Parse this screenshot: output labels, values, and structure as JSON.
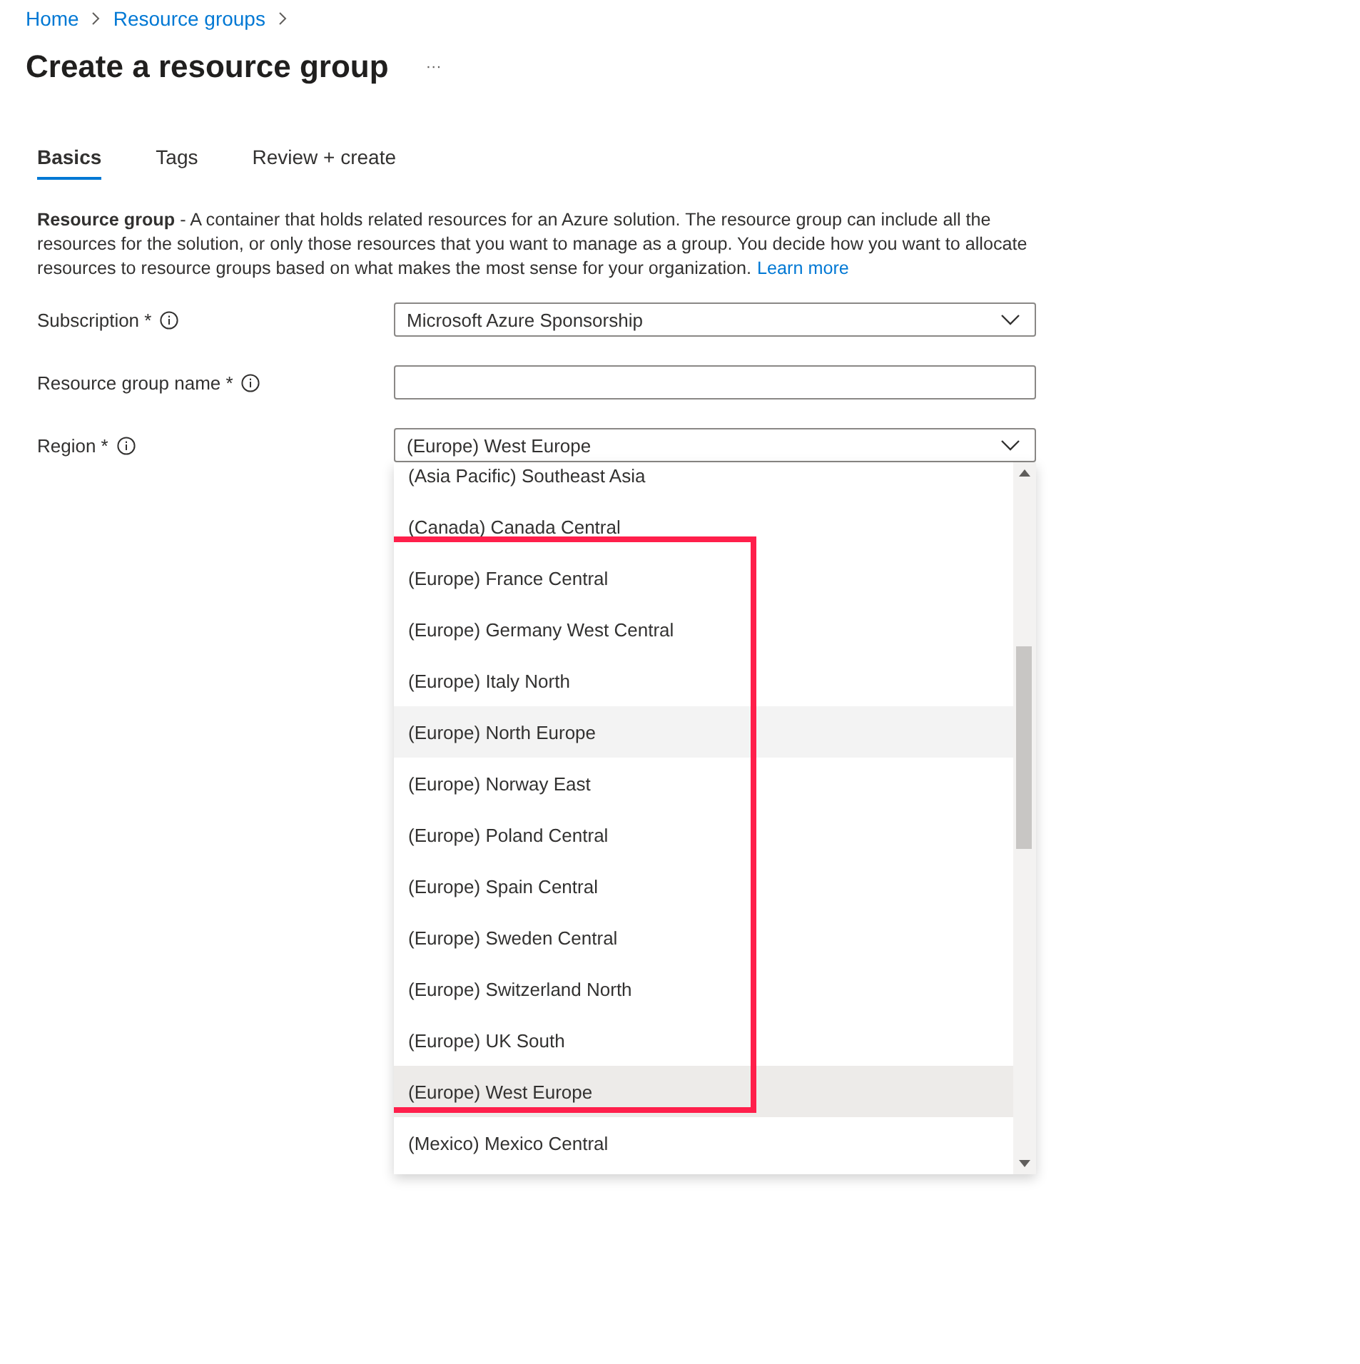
{
  "breadcrumb": [
    "Home",
    "Resource groups"
  ],
  "title": "Create a resource group",
  "more_button": "···",
  "tabs": [
    {
      "label": "Basics",
      "selected": true
    },
    {
      "label": "Tags",
      "selected": false
    },
    {
      "label": "Review + create",
      "selected": false
    }
  ],
  "description": {
    "text": "**Resource group** - A container that holds related resources for an Azure solution. The resource group can include all the resources for the solution, or only those resources that you want to manage as a group. You decide how you want to allocate resources to resource groups based on what makes the most sense for your organization.",
    "link": "Learn more"
  },
  "fields": [
    {
      "label": "Subscription *",
      "kind": "dropdown",
      "value": "Microsoft Azure Sponsorship"
    },
    {
      "label": "Resource group name *",
      "kind": "text"
    },
    {
      "label": "Region *",
      "kind": "dropdown",
      "value": "(Europe) West Europe",
      "options_before": [
        {
          "label": "(Asia Pacific) Southeast Asia",
          "selected": false,
          "hovered": false
        },
        {
          "label": "(Canada) Canada Central",
          "selected": false,
          "hovered": false
        }
      ],
      "highlighted_options": [
        {
          "label": "(Europe) France Central",
          "selected": false,
          "hovered": false
        },
        {
          "label": "(Europe) Germany West Central",
          "selected": false,
          "hovered": false
        },
        {
          "label": "(Europe) Italy North",
          "selected": false,
          "hovered": false
        },
        {
          "label": "(Europe) North Europe",
          "selected": false,
          "hovered": true
        },
        {
          "label": "(Europe) Norway East",
          "selected": false,
          "hovered": false
        },
        {
          "label": "(Europe) Poland Central",
          "selected": false,
          "hovered": false
        },
        {
          "label": "(Europe) Spain Central",
          "selected": false,
          "hovered": false
        },
        {
          "label": "(Europe) Sweden Central",
          "selected": false,
          "hovered": false
        },
        {
          "label": "(Europe) Switzerland North",
          "selected": false,
          "hovered": false
        },
        {
          "label": "(Europe) UK South",
          "selected": false,
          "hovered": false
        },
        {
          "label": "(Europe) West Europe",
          "selected": true,
          "hovered": false
        }
      ],
      "options_after": [
        {
          "label": "(Mexico) Mexico Central",
          "selected": false,
          "hovered": false
        }
      ]
    }
  ]
}
